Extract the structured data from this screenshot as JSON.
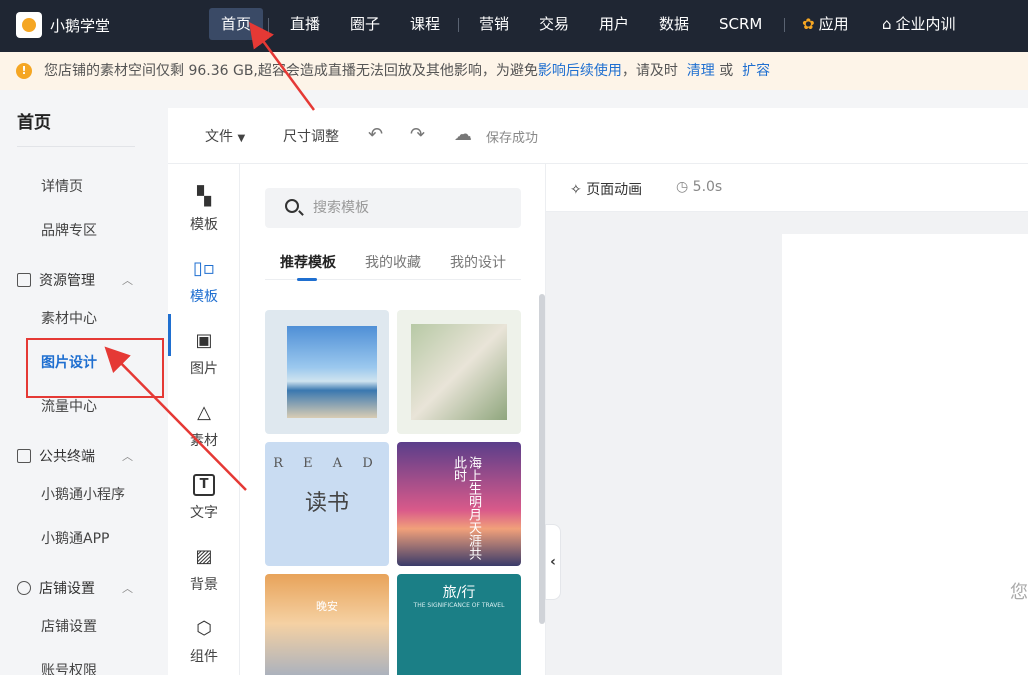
{
  "brand": {
    "name": "小鹅学堂"
  },
  "nav": {
    "items": [
      {
        "label": "首页",
        "active": true
      },
      {
        "label": "直播"
      },
      {
        "label": "圈子"
      },
      {
        "label": "课程"
      },
      {
        "label": "营销"
      },
      {
        "label": "交易"
      },
      {
        "label": "用户"
      },
      {
        "label": "数据"
      },
      {
        "label": "SCRM"
      },
      {
        "label": "应用"
      },
      {
        "label": "企业内训"
      }
    ]
  },
  "warning": {
    "text_before": "您店铺的素材空间仅剩 96.36 GB,超容会造成直播无法回放及其他影响，为避免",
    "link_impact": "影响后续使用",
    "text_middle": "，请及时",
    "link_clean": "清理",
    "text_or": "或",
    "link_expand": "扩容"
  },
  "sidebar": {
    "title": "首页",
    "items": [
      {
        "label": "详情页"
      },
      {
        "label": "品牌专区"
      }
    ],
    "groups": [
      {
        "label": "资源管理",
        "items": [
          "素材中心",
          "图片设计",
          "流量中心"
        ]
      },
      {
        "label": "公共终端",
        "items": [
          "小鹅通小程序",
          "小鹅通APP"
        ]
      },
      {
        "label": "店铺设置",
        "items": [
          "店铺设置",
          "账号权限"
        ]
      }
    ],
    "active_item": "图片设计"
  },
  "toolbar": {
    "file": "文件",
    "resize": "尺寸调整",
    "save_status": "保存成功"
  },
  "rail": {
    "items": [
      {
        "label": "模板",
        "icon": "template-icon"
      },
      {
        "label": "模板",
        "icon": "layout-icon",
        "active": true
      },
      {
        "label": "图片",
        "icon": "image-icon"
      },
      {
        "label": "素材",
        "icon": "shapes-icon"
      },
      {
        "label": "文字",
        "icon": "text-icon"
      },
      {
        "label": "背景",
        "icon": "background-icon"
      },
      {
        "label": "组件",
        "icon": "component-icon"
      }
    ]
  },
  "panel": {
    "search_placeholder": "搜索模板",
    "tabs": [
      {
        "label": "推荐模板",
        "active": true
      },
      {
        "label": "我的收藏"
      },
      {
        "label": "我的设计"
      }
    ],
    "templates": {
      "t3_title": "R E A D",
      "t3_text": "读书",
      "t4_text": "海上生明月天涯共此时",
      "t5_text": "晚安",
      "t6_title": "旅/行",
      "t6_sub": "THE SIGNIFICANCE OF TRAVEL"
    }
  },
  "canvas": {
    "animation": "页面动画",
    "duration": "5.0s",
    "hint": "您"
  },
  "colors": {
    "accent": "#1f6fd0",
    "topbar": "#1f2633",
    "warning_bg": "#fdf4e8",
    "annotation_red": "#e53935"
  }
}
